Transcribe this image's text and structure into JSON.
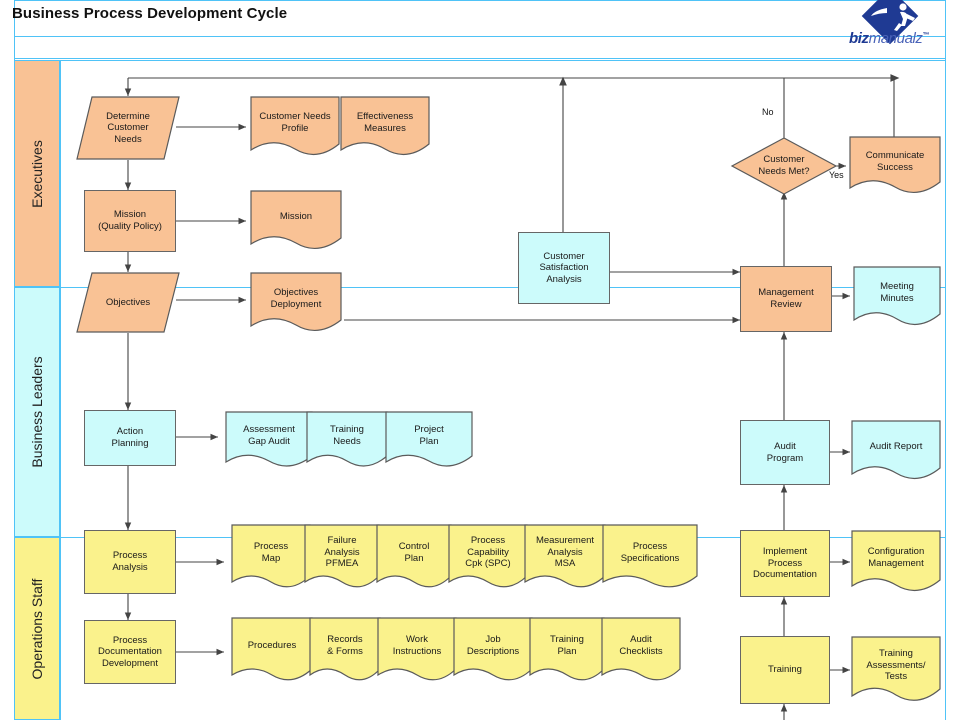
{
  "header": {
    "title": "Business Process Development Cycle",
    "logo_text_bold": "biz",
    "logo_text_light": "manualz",
    "logo_tm": "™",
    "logo_icon": "bizmanualz-diamond-runner-logo"
  },
  "theme": {
    "orange_fill": "#F9C295",
    "cyan_fill": "#CCFBFB",
    "yellow_fill": "#FAF28C",
    "shape_stroke": "#5a5a5a",
    "lane_stroke": "#4FC3F7",
    "connector": "#444444",
    "logo_blue": "#1F3A93"
  },
  "lanes": [
    {
      "id": "executives",
      "label": "Executives",
      "fill": "#F9C295"
    },
    {
      "id": "business-leaders",
      "label": "Business Leaders",
      "fill": "#CCFBFB"
    },
    {
      "id": "operations-staff",
      "label": "Operations Staff",
      "fill": "#FAF28C"
    }
  ],
  "nodes": {
    "determine_customer_needs": {
      "label": "Determine\nCustomer\nNeeds",
      "shape": "parallelogram",
      "fill": "#F9C295"
    },
    "customer_needs_profile": {
      "label": "Customer Needs\nProfile",
      "shape": "document",
      "fill": "#F9C295"
    },
    "effectiveness_measures": {
      "label": "Effectiveness\nMeasures",
      "shape": "document",
      "fill": "#F9C295"
    },
    "mission_quality_policy": {
      "label": "Mission\n(Quality Policy)",
      "shape": "process",
      "fill": "#F9C295"
    },
    "mission_doc": {
      "label": "Mission",
      "shape": "document",
      "fill": "#F9C295"
    },
    "objectives": {
      "label": "Objectives",
      "shape": "parallelogram",
      "fill": "#F9C295"
    },
    "objectives_deployment": {
      "label": "Objectives\nDeployment",
      "shape": "document",
      "fill": "#F9C295"
    },
    "customer_satisfaction_analysis": {
      "label": "Customer\nSatisfaction\nAnalysis",
      "shape": "process",
      "fill": "#CCFBFB"
    },
    "customer_needs_met": {
      "label": "Customer\nNeeds Met?",
      "shape": "decision",
      "fill": "#F9C295"
    },
    "communicate_success": {
      "label": "Communicate\nSuccess",
      "shape": "document",
      "fill": "#F9C295"
    },
    "management_review": {
      "label": "Management\nReview",
      "shape": "process",
      "fill": "#F9C295"
    },
    "meeting_minutes": {
      "label": "Meeting\nMinutes",
      "shape": "document",
      "fill": "#CCFBFB"
    },
    "action_planning": {
      "label": "Action\nPlanning",
      "shape": "process",
      "fill": "#CCFBFB"
    },
    "assessment_gap_audit": {
      "label": "Assessment\nGap Audit",
      "shape": "document",
      "fill": "#CCFBFB"
    },
    "training_needs": {
      "label": "Training\nNeeds",
      "shape": "document",
      "fill": "#CCFBFB"
    },
    "project_plan": {
      "label": "Project\nPlan",
      "shape": "document",
      "fill": "#CCFBFB"
    },
    "audit_program": {
      "label": "Audit\nProgram",
      "shape": "process",
      "fill": "#CCFBFB"
    },
    "audit_report": {
      "label": "Audit Report",
      "shape": "document",
      "fill": "#CCFBFB"
    },
    "process_analysis": {
      "label": "Process\nAnalysis",
      "shape": "process",
      "fill": "#FAF28C"
    },
    "process_map": {
      "label": "Process\nMap",
      "shape": "document",
      "fill": "#FAF28C"
    },
    "failure_analysis_pfmea": {
      "label": "Failure\nAnalysis\nPFMEA",
      "shape": "document",
      "fill": "#FAF28C"
    },
    "control_plan": {
      "label": "Control\nPlan",
      "shape": "document",
      "fill": "#FAF28C"
    },
    "process_capability_cpk": {
      "label": "Process\nCapability\nCpk (SPC)",
      "shape": "document",
      "fill": "#FAF28C"
    },
    "measurement_analysis_msa": {
      "label": "Measurement\nAnalysis\nMSA",
      "shape": "document",
      "fill": "#FAF28C"
    },
    "process_specifications": {
      "label": "Process\nSpecifications",
      "shape": "document",
      "fill": "#FAF28C"
    },
    "process_documentation_development": {
      "label": "Process\nDocumentation\nDevelopment",
      "shape": "process",
      "fill": "#FAF28C"
    },
    "procedures": {
      "label": "Procedures",
      "shape": "document",
      "fill": "#FAF28C"
    },
    "records_and_forms": {
      "label": "Records\n& Forms",
      "shape": "document",
      "fill": "#FAF28C"
    },
    "work_instructions": {
      "label": "Work\nInstructions",
      "shape": "document",
      "fill": "#FAF28C"
    },
    "job_descriptions": {
      "label": "Job\nDescriptions",
      "shape": "document",
      "fill": "#FAF28C"
    },
    "training_plan": {
      "label": "Training\nPlan",
      "shape": "document",
      "fill": "#FAF28C"
    },
    "audit_checklists": {
      "label": "Audit\nChecklists",
      "shape": "document",
      "fill": "#FAF28C"
    },
    "implement_process_documentation": {
      "label": "Implement\nProcess\nDocumentation",
      "shape": "process",
      "fill": "#FAF28C"
    },
    "configuration_management": {
      "label": "Configuration\nManagement",
      "shape": "document",
      "fill": "#FAF28C"
    },
    "training": {
      "label": "Training",
      "shape": "process",
      "fill": "#FAF28C"
    },
    "training_assessments_tests": {
      "label": "Training\nAssessments/\nTests",
      "shape": "document",
      "fill": "#FAF28C"
    }
  },
  "edge_labels": {
    "no": "No",
    "yes": "Yes"
  }
}
